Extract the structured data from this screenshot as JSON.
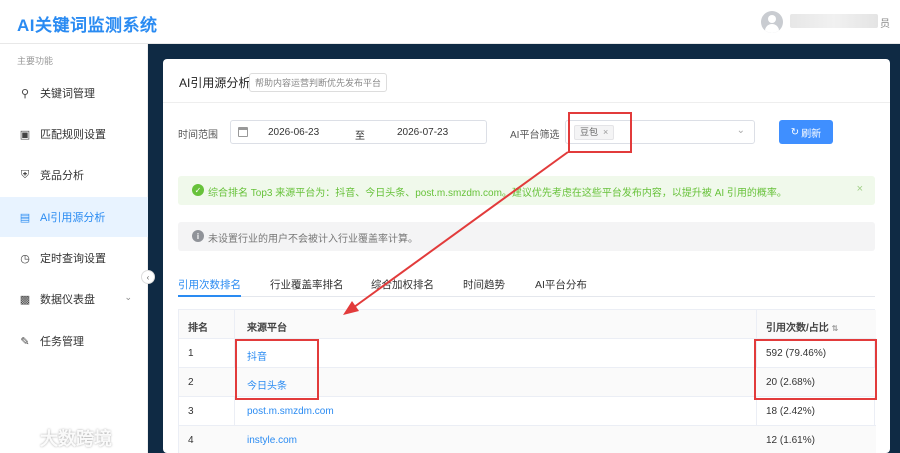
{
  "app": {
    "title": "AI关键词监测系统",
    "user_suffix": "员"
  },
  "sidebar": {
    "group_label": "主要功能",
    "items": [
      {
        "label": "关键词管理",
        "icon": "key-icon"
      },
      {
        "label": "匹配规则设置",
        "icon": "document-icon"
      },
      {
        "label": "竞品分析",
        "icon": "trophy-icon"
      },
      {
        "label": "AI引用源分析",
        "icon": "file-icon",
        "active": true
      },
      {
        "label": "定时查询设置",
        "icon": "timer-icon"
      },
      {
        "label": "数据仪表盘",
        "icon": "chart-icon",
        "expandable": true
      },
      {
        "label": "任务管理",
        "icon": "task-icon"
      }
    ]
  },
  "card": {
    "title": "AI引用源分析",
    "hint": "帮助内容运营判断优先发布平台"
  },
  "filters": {
    "time_label": "时间范围",
    "start_date": "2026-06-23",
    "range_sep": "至",
    "end_date": "2026-07-23",
    "platform_label": "AI平台筛选",
    "platform_tag": "豆包",
    "refresh_label": "刷新"
  },
  "alerts": {
    "success": "综合排名 Top3 来源平台为：抖音、今日头条、post.m.smzdm.com。建议优先考虑在这些平台发布内容，以提升被 AI 引用的概率。",
    "info": "未设置行业的用户不会被计入行业覆盖率计算。"
  },
  "tabs": [
    "引用次数排名",
    "行业覆盖率排名",
    "综合加权排名",
    "时间趋势",
    "AI平台分布"
  ],
  "table": {
    "headers": {
      "rank": "排名",
      "source": "来源平台",
      "citations": "引用次数/占比"
    },
    "rows": [
      {
        "rank": "1",
        "source": "抖音",
        "citations": "592 (79.46%)"
      },
      {
        "rank": "2",
        "source": "今日头条",
        "citations": "20 (2.68%)"
      },
      {
        "rank": "3",
        "source": "post.m.smzdm.com",
        "citations": "18 (2.42%)"
      },
      {
        "rank": "4",
        "source": "instyle.com",
        "citations": "12 (1.61%)"
      }
    ]
  },
  "watermark": "大数跨境",
  "colors": {
    "accent": "#2a8bf2",
    "annotation": "#e23b3b",
    "success": "#67c23a",
    "backdrop": "#0f2a44"
  }
}
